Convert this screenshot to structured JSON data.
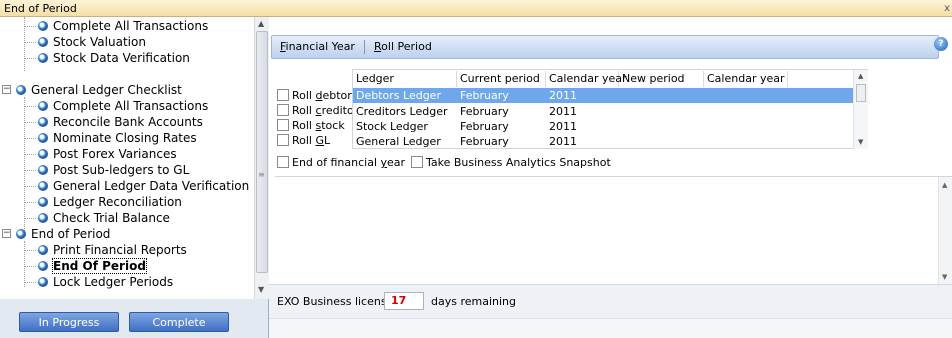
{
  "window": {
    "title": "End of Period",
    "close_glyph": "x"
  },
  "tree": {
    "items": [
      {
        "label": "Complete All Transactions",
        "bold": false
      },
      {
        "label": "Stock Valuation",
        "bold": false
      },
      {
        "label": "Stock Data Verification",
        "bold": false
      },
      {
        "label": "General Ledger Checklist",
        "bold": false
      },
      {
        "label": "Complete All Transactions",
        "bold": false
      },
      {
        "label": "Reconcile Bank Accounts",
        "bold": false
      },
      {
        "label": "Nominate Closing Rates",
        "bold": false
      },
      {
        "label": "Post Forex Variances",
        "bold": false
      },
      {
        "label": "Post Sub-ledgers to GL",
        "bold": false
      },
      {
        "label": "General Ledger Data Verification",
        "bold": false
      },
      {
        "label": "Ledger Reconciliation",
        "bold": false
      },
      {
        "label": "Check Trial Balance",
        "bold": false
      },
      {
        "label": "End of Period",
        "bold": false
      },
      {
        "label": "Print Financial Reports",
        "bold": false
      },
      {
        "label": "End Of Period",
        "bold": true
      },
      {
        "label": "Lock Ledger Periods",
        "bold": false
      }
    ]
  },
  "footer": {
    "in_progress": "In Progress",
    "complete": "Complete"
  },
  "tabs": [
    {
      "label": "Financial Year",
      "accel": "F",
      "rest": "inancial Year"
    },
    {
      "label": "Roll Period",
      "accel": "R",
      "rest": "oll Period"
    }
  ],
  "roll": [
    {
      "pre": "Roll ",
      "accel": "d",
      "post": "ebtors"
    },
    {
      "pre": "Roll ",
      "accel": "c",
      "post": "reditors"
    },
    {
      "pre": "Roll ",
      "accel": "s",
      "post": "tock"
    },
    {
      "pre": "Roll ",
      "accel": "G",
      "post": "L"
    }
  ],
  "grid": {
    "headers": [
      "Ledger",
      "Current period",
      "Calendar year",
      "New period",
      "Calendar year"
    ],
    "rows": [
      [
        "Debtors Ledger",
        "February",
        "2011",
        "",
        ""
      ],
      [
        "Creditors Ledger",
        "February",
        "2011",
        "",
        ""
      ],
      [
        "Stock Ledger",
        "February",
        "2011",
        "",
        ""
      ],
      [
        "General Ledger",
        "February",
        "2011",
        "",
        ""
      ]
    ]
  },
  "options": {
    "end_fy_pre": "End of financial ",
    "end_fy_accel": "y",
    "end_fy_post": "ear",
    "snapshot": "Take Business Analytics Snapshot"
  },
  "status": {
    "licensing_label": "EXO Business licensing:",
    "days_value": "17",
    "days_suffix": "days remaining"
  },
  "colors": {
    "accent": "#6fa7ec",
    "days": "#d50000",
    "title_bar": "#f4dfa3"
  }
}
